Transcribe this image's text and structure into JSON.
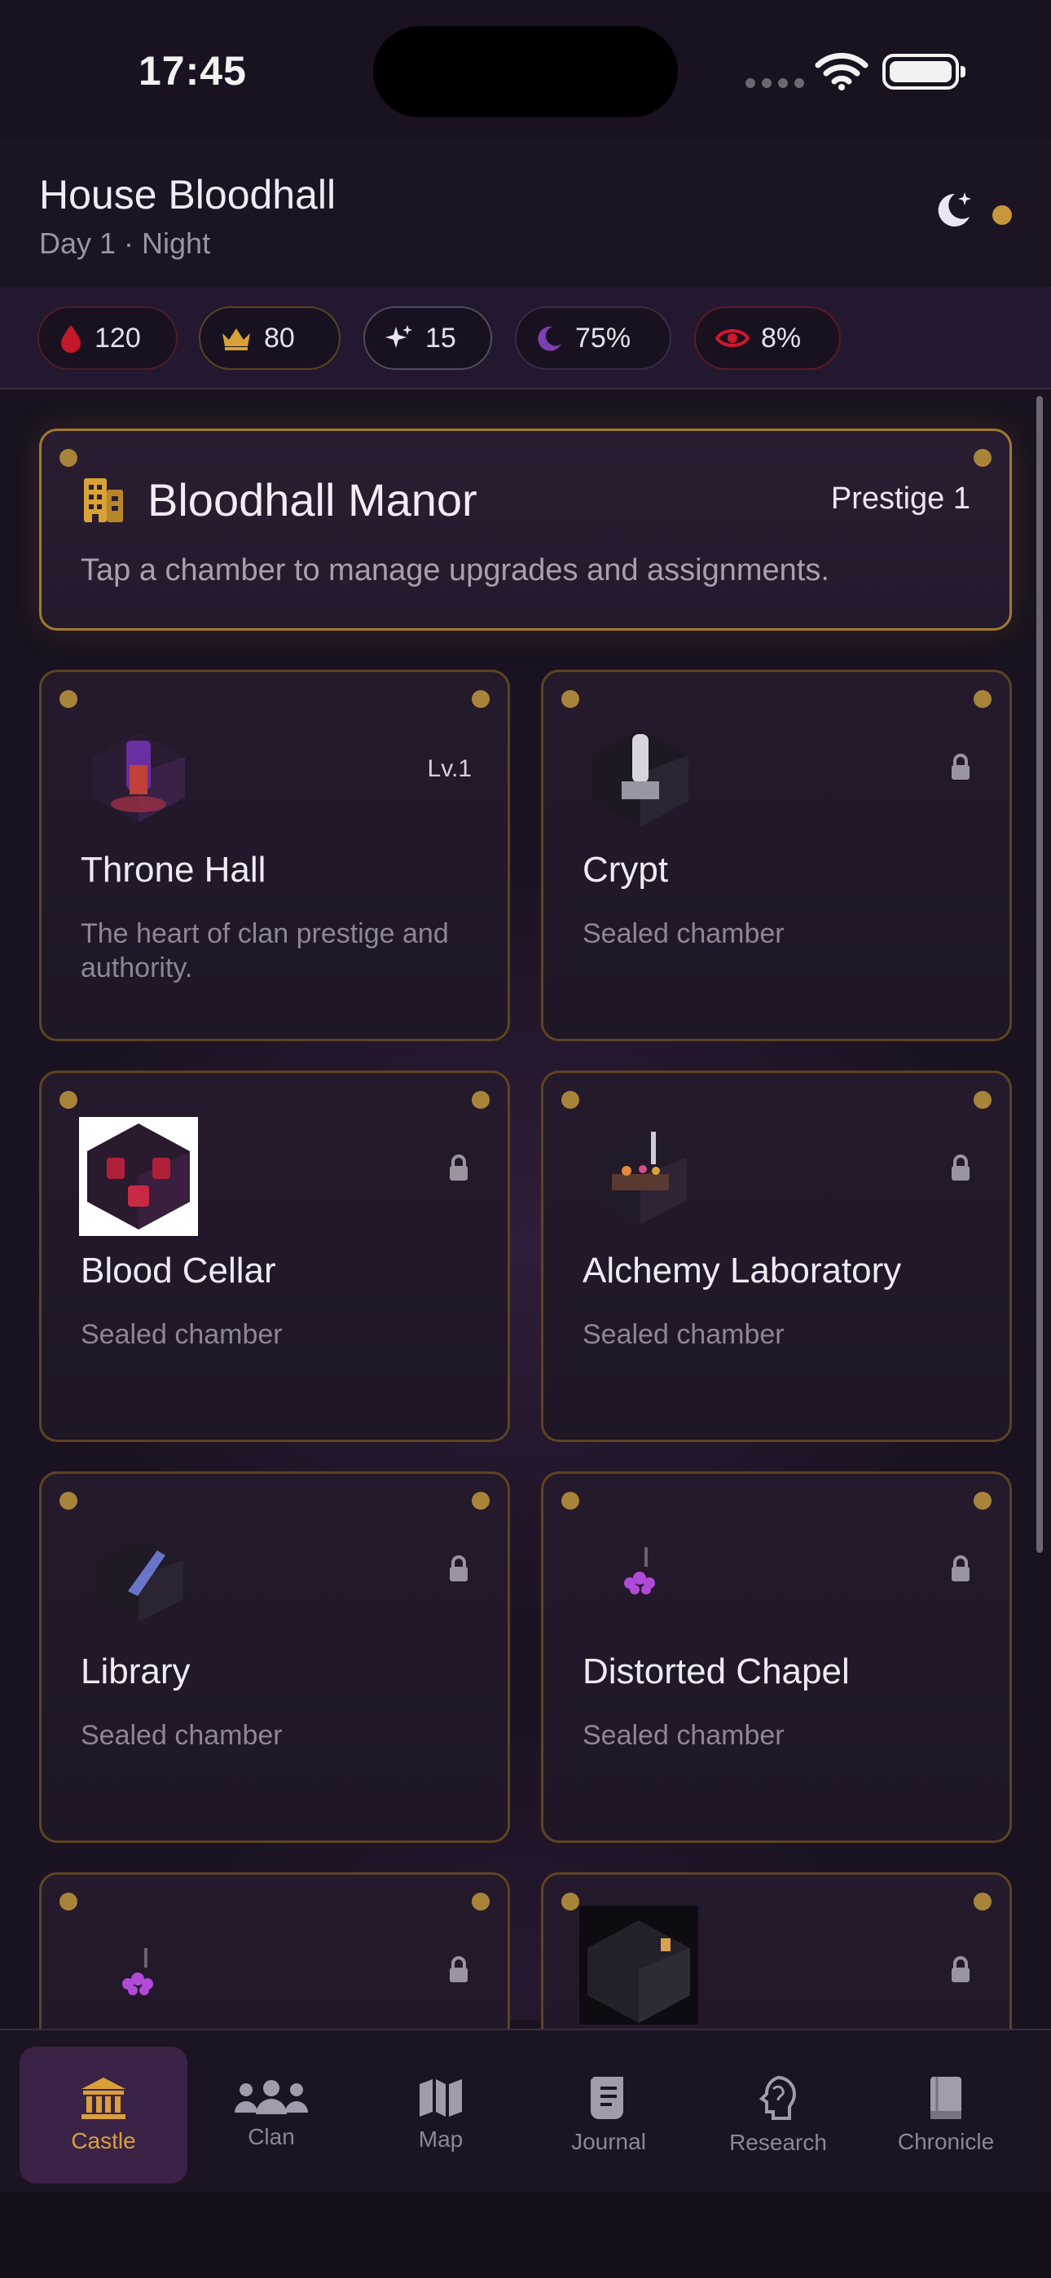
{
  "status_bar": {
    "time": "17:45"
  },
  "header": {
    "title": "House Bloodhall",
    "subtitle": "Day 1 · Night"
  },
  "resources": [
    {
      "name": "blood",
      "value": "120",
      "color": "#c4182c"
    },
    {
      "name": "prestige-crown",
      "value": "80",
      "color": "#d8a235"
    },
    {
      "name": "spark",
      "value": "15",
      "color": "#e6e6f0"
    },
    {
      "name": "moon",
      "value": "75%",
      "color": "#7c3fb0"
    },
    {
      "name": "eye",
      "value": "8%",
      "color": "#d0182c"
    }
  ],
  "manor": {
    "title": "Bloodhall Manor",
    "prestige": "Prestige 1",
    "subtitle": "Tap a chamber to manage upgrades and assignments."
  },
  "chambers": [
    {
      "name": "Throne Hall",
      "desc": "The heart of clan prestige and authority.",
      "level": "Lv.1",
      "locked": false,
      "icon": "throne-hall-image"
    },
    {
      "name": "Crypt",
      "desc": "Sealed chamber",
      "locked": true,
      "icon": "crypt-image"
    },
    {
      "name": "Blood Cellar",
      "desc": "Sealed chamber",
      "locked": true,
      "icon": "blood-cellar-image"
    },
    {
      "name": "Alchemy Laboratory",
      "desc": "Sealed chamber",
      "locked": true,
      "icon": "alchemy-lab-image"
    },
    {
      "name": "Library",
      "desc": "Sealed chamber",
      "locked": true,
      "icon": "library-image"
    },
    {
      "name": "Distorted Chapel",
      "desc": "Sealed chamber",
      "locked": true,
      "icon": "distorted-chapel-image"
    },
    {
      "name": "",
      "desc": "",
      "locked": true,
      "icon": "chamber-image"
    },
    {
      "name": "",
      "desc": "",
      "locked": true,
      "icon": "chamber-image"
    }
  ],
  "tabs": [
    {
      "label": "Castle",
      "icon": "castle-icon",
      "active": true
    },
    {
      "label": "Clan",
      "icon": "clan-icon",
      "active": false
    },
    {
      "label": "Map",
      "icon": "map-icon",
      "active": false
    },
    {
      "label": "Journal",
      "icon": "journal-icon",
      "active": false
    },
    {
      "label": "Research",
      "icon": "research-icon",
      "active": false
    },
    {
      "label": "Chronicle",
      "icon": "chronicle-icon",
      "active": false
    }
  ],
  "colors": {
    "accent_gold": "#d9a03a",
    "background": "#1a1220",
    "card_border": "#5c4422"
  }
}
